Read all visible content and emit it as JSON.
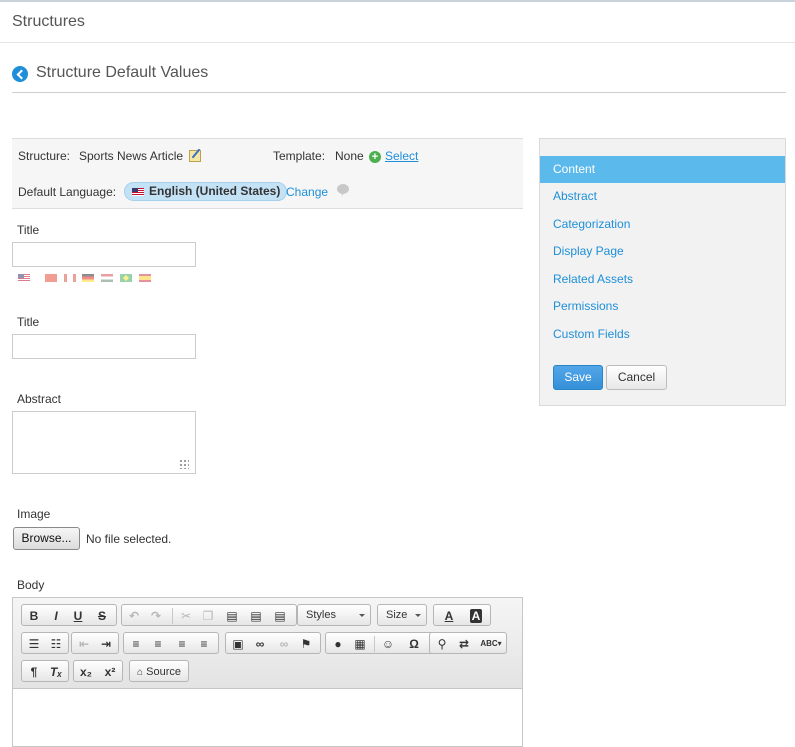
{
  "header": {
    "title": "Structures"
  },
  "page": {
    "subtitle": "Structure Default Values"
  },
  "info": {
    "structure_label": "Structure:",
    "structure_value": "Sports News Article",
    "template_label": "Template:",
    "template_value": "None",
    "select_link": "Select",
    "language_label": "Default Language:",
    "language_value": "English (United States)",
    "change_link": "Change"
  },
  "form": {
    "title_label": "Title",
    "title2_label": "Title",
    "abstract_label": "Abstract",
    "image_label": "Image",
    "browse_button": "Browse...",
    "no_file": "No file selected.",
    "body_label": "Body"
  },
  "editor": {
    "toolbar": {
      "bold": "B",
      "italic": "I",
      "underline": "U",
      "strike": "S",
      "styles": "Styles",
      "size": "Size",
      "subscript": "x₂",
      "superscript": "x²",
      "source": "Source"
    }
  },
  "sidebar": {
    "items": [
      {
        "label": "Content"
      },
      {
        "label": "Abstract"
      },
      {
        "label": "Categorization"
      },
      {
        "label": "Display Page"
      },
      {
        "label": "Related Assets"
      },
      {
        "label": "Permissions"
      },
      {
        "label": "Custom Fields"
      }
    ],
    "save": "Save",
    "cancel": "Cancel"
  },
  "colors": {
    "accent": "#1e8fd8",
    "nav_active": "#5bb9ec",
    "save_button": "#3590d8"
  }
}
